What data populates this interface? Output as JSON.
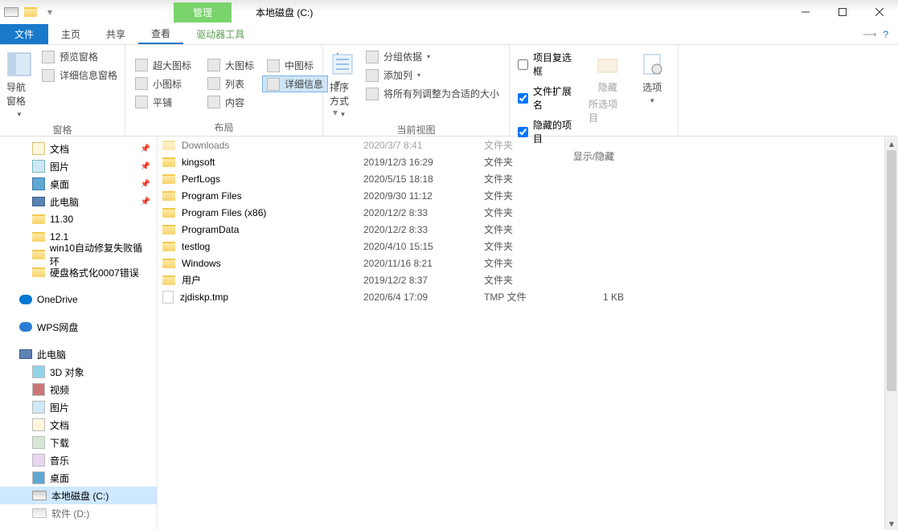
{
  "title": "本地磁盘 (C:)",
  "contextTab": "管理",
  "menubar": {
    "file": "文件",
    "home": "主页",
    "share": "共享",
    "view": "查看",
    "drive": "驱动器工具"
  },
  "ribbon": {
    "panes": {
      "nav": "导航窗格",
      "preview": "预览窗格",
      "details": "详细信息窗格",
      "label": "窗格"
    },
    "layout": {
      "xl": "超大图标",
      "lg": "大图标",
      "md": "中图标",
      "sm": "小图标",
      "list": "列表",
      "detail": "详细信息",
      "tile": "平铺",
      "content": "内容",
      "label": "布局"
    },
    "currentview": {
      "sort": "排序方式",
      "group": "分组依据",
      "addcol": "添加列",
      "fitcol": "将所有列调整为合适的大小",
      "label": "当前视图"
    },
    "showhide": {
      "itemcheck": "项目复选框",
      "ext": "文件扩展名",
      "hidden": "隐藏的项目",
      "hide": "隐藏",
      "hidesel": "所选项目",
      "options": "选项",
      "label": "显示/隐藏"
    }
  },
  "nav": {
    "documents": "文档",
    "pictures": "图片",
    "desktop": "桌面",
    "thispc": "此电脑",
    "f1": "11.30",
    "f2": "12.1",
    "f3": "win10自动修复失败循环",
    "f4": "硬盘格式化0007错误",
    "onedrive": "OneDrive",
    "wps": "WPS网盘",
    "thispc2": "此电脑",
    "3d": "3D 对象",
    "video": "视频",
    "pics2": "图片",
    "docs2": "文档",
    "downloads": "下载",
    "music": "音乐",
    "desktop2": "桌面",
    "cdrive": "本地磁盘 (C:)",
    "ddrive": "软件 (D:)"
  },
  "files": [
    {
      "name": "Downloads",
      "date": "2020/3/7 8:41",
      "type": "文件夹",
      "size": "",
      "kind": "folder",
      "cut": true
    },
    {
      "name": "kingsoft",
      "date": "2019/12/3 16:29",
      "type": "文件夹",
      "size": "",
      "kind": "folder"
    },
    {
      "name": "PerfLogs",
      "date": "2020/5/15 18:18",
      "type": "文件夹",
      "size": "",
      "kind": "folder"
    },
    {
      "name": "Program Files",
      "date": "2020/9/30 11:12",
      "type": "文件夹",
      "size": "",
      "kind": "folder"
    },
    {
      "name": "Program Files (x86)",
      "date": "2020/12/2 8:33",
      "type": "文件夹",
      "size": "",
      "kind": "folder"
    },
    {
      "name": "ProgramData",
      "date": "2020/12/2 8:33",
      "type": "文件夹",
      "size": "",
      "kind": "folder"
    },
    {
      "name": "testlog",
      "date": "2020/4/10 15:15",
      "type": "文件夹",
      "size": "",
      "kind": "folder"
    },
    {
      "name": "Windows",
      "date": "2020/11/16 8:21",
      "type": "文件夹",
      "size": "",
      "kind": "folder"
    },
    {
      "name": "用户",
      "date": "2019/12/2 8:37",
      "type": "文件夹",
      "size": "",
      "kind": "folder"
    },
    {
      "name": "zjdiskp.tmp",
      "date": "2020/6/4 17:09",
      "type": "TMP 文件",
      "size": "1 KB",
      "kind": "file"
    }
  ]
}
